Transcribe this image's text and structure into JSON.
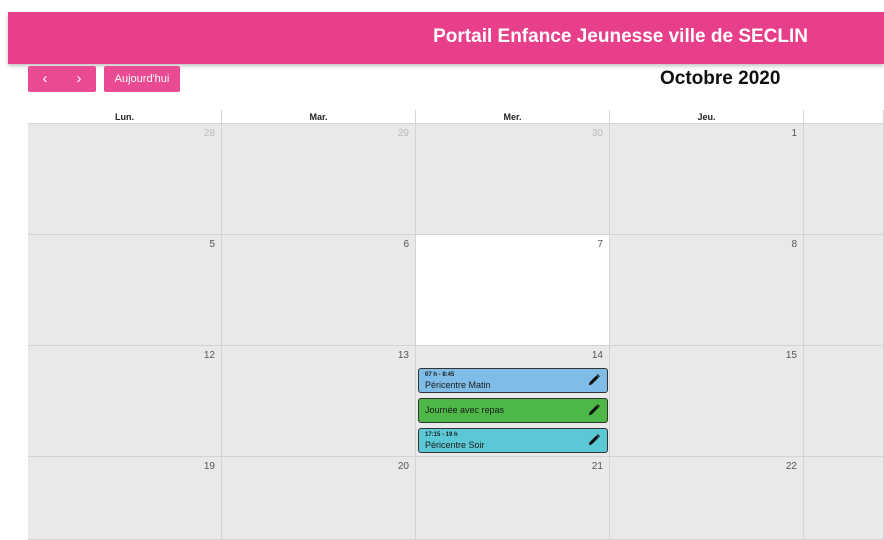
{
  "app": {
    "title": "Portail Enfance Jeunesse ville de SECLIN"
  },
  "toolbar": {
    "prev_label": "‹",
    "next_label": "›",
    "today_label": "Aujourd'hui",
    "month_label": "Octobre 2020"
  },
  "calendar": {
    "headers": [
      "Lun.",
      "Mar.",
      "Mer.",
      "Jeu.",
      ""
    ],
    "weeks": [
      [
        "28",
        "29",
        "30",
        "1",
        ""
      ],
      [
        "5",
        "6",
        "7",
        "8",
        ""
      ],
      [
        "12",
        "13",
        "14",
        "15",
        ""
      ],
      [
        "19",
        "20",
        "21",
        "22",
        ""
      ]
    ],
    "events": [
      {
        "time": "07 h - 8:45",
        "title": "Péricentre Matin",
        "color": "#7fbde8",
        "icon": "pencil-icon"
      },
      {
        "time": "",
        "title": "Journée avec repas",
        "color": "#4db848",
        "icon": "pencil-icon"
      },
      {
        "time": "17:15 - 19 h",
        "title": "Péricentre Soir",
        "color": "#5bc8d6",
        "icon": "pencil-icon"
      }
    ]
  },
  "colors": {
    "accent": "#e83f8b",
    "today_bg": "#ffffff",
    "cell_bg": "#e9e9e9"
  }
}
